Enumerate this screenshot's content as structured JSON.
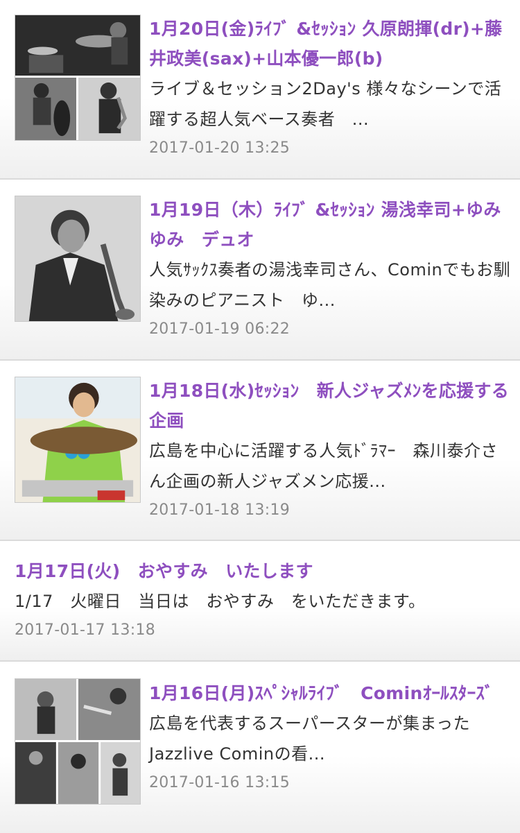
{
  "posts": [
    {
      "title": "1月20日(金)ﾗｲﾌﾞ &ｾｯｼｮﾝ 久原朗揮(dr)+藤井政美(sax)+山本優一郎(b)",
      "excerpt": "ライブ＆セッション2Day's 様々なシーンで活躍する超人気ベース奏者　...",
      "date": "2017-01-20 13:25",
      "thumbnail": "jazz-trio-collage-photo"
    },
    {
      "title": "1月19日（木）ﾗｲﾌﾞ &ｾｯｼｮﾝ 湯浅幸司+ゆみゆみ　デュオ",
      "excerpt": "人気ｻｯｸｽ奏者の湯浅幸司さん、Cominでもお馴染みのピアニスト　ゆ...",
      "date": "2017-01-19 06:22",
      "thumbnail": "saxophonist-portrait-photo"
    },
    {
      "title": "1月18日(水)ｾｯｼｮﾝ　新人ジャズﾒﾝを応援する企画",
      "excerpt": "広島を中心に活躍する人気ﾄﾞﾗﾏｰ　森川泰介さん企画の新人ジャズメン応援...",
      "date": "2017-01-18 13:19",
      "thumbnail": "drummer-photo"
    },
    {
      "title": "1月17日(火)　おやすみ　いたします",
      "excerpt": "1/17　火曜日　当日は　おやすみ　をいただきます。",
      "date": "2017-01-17 13:18",
      "thumbnail": null
    },
    {
      "title": "1月16日(月)ｽﾍﾟｼｬﾙﾗｲﾌﾞ　Cominｵｰﾙｽﾀｰｽﾞ",
      "excerpt": "広島を代表するスーパースターが集まった　Jazzlive Cominの看...",
      "date": "2017-01-16 13:15",
      "thumbnail": "all-stars-collage-photo"
    }
  ]
}
